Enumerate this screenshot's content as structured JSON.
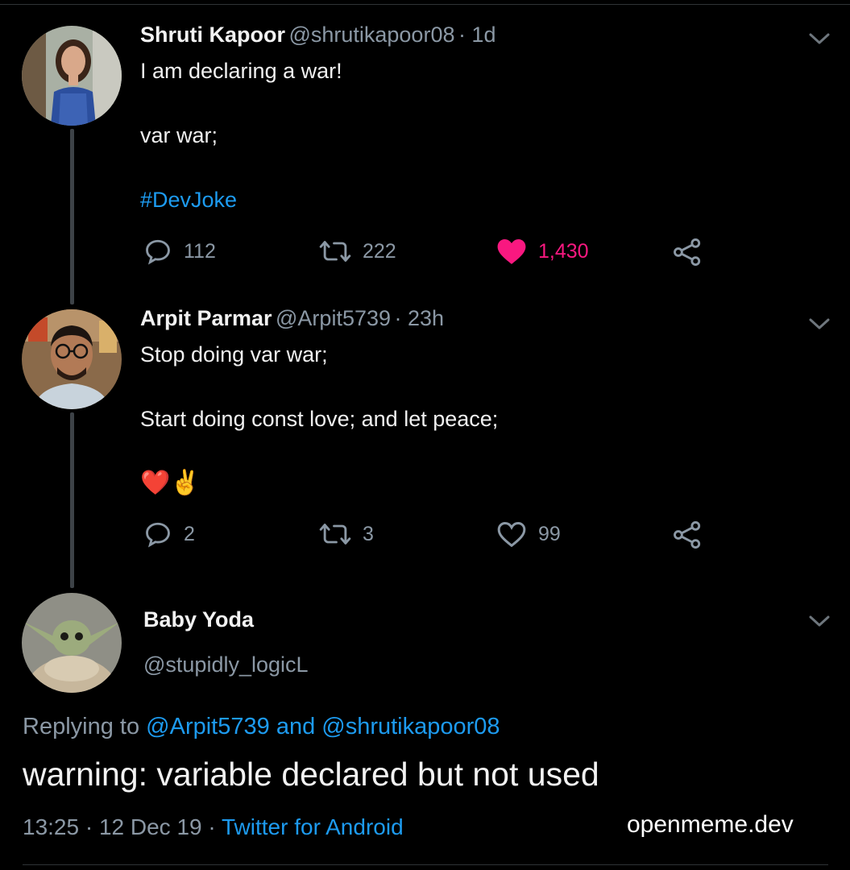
{
  "thread": [
    {
      "name": "Shruti Kapoor",
      "handle": "@shrutikapoor08",
      "time": "· 1d",
      "lines": [
        "I am declaring a war!",
        "var war;",
        "#DevJoke"
      ],
      "actions": {
        "replies": "112",
        "retweets": "222",
        "likes": "1,430",
        "liked": true
      }
    },
    {
      "name": "Arpit Parmar",
      "handle": "@Arpit5739",
      "time": "· 23h",
      "lines": [
        "Stop doing var war;",
        "Start doing const love; and let peace;",
        "❤️✌️"
      ],
      "actions": {
        "replies": "2",
        "retweets": "3",
        "likes": "99",
        "liked": false
      }
    }
  ],
  "focused": {
    "name": "Baby Yoda",
    "handle": "@stupidly_logicL",
    "replying_prefix": "Replying to",
    "replying_user1": "@Arpit5739",
    "replying_and": "and",
    "replying_user2": "@shrutikapoor08",
    "text": "warning: variable declared but not used",
    "timestamp": "13:25 · 12 Dec 19 ·",
    "client": "Twitter for Android"
  },
  "watermark": "openmeme.dev",
  "icons": {
    "more": "chevron-down-icon",
    "reply": "reply-icon",
    "retweet": "retweet-icon",
    "like": "heart-icon",
    "share": "share-icon"
  },
  "colors": {
    "background": "#000000",
    "accent": "#1d9bf0",
    "like": "#f91880",
    "secondary_text": "#8b98a5"
  }
}
